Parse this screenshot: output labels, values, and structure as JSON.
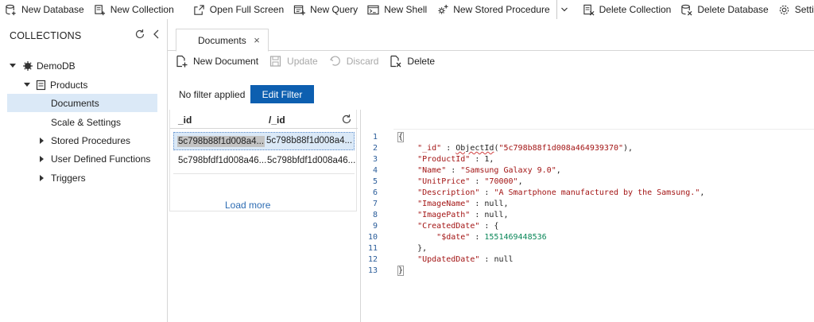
{
  "toolbar": {
    "new_database": "New Database",
    "new_collection": "New Collection",
    "open_full_screen": "Open Full Screen",
    "new_query": "New Query",
    "new_shell": "New Shell",
    "new_stored_procedure": "New Stored Procedure",
    "delete_collection": "Delete Collection",
    "delete_database": "Delete Database",
    "settings": "Settings"
  },
  "sidebar": {
    "header": "COLLECTIONS",
    "database": "DemoDB",
    "collection": "Products",
    "items": [
      {
        "label": "Documents",
        "selected": true
      },
      {
        "label": "Scale & Settings"
      },
      {
        "label": "Stored Procedures",
        "expandable": true
      },
      {
        "label": "User Defined Functions",
        "expandable": true
      },
      {
        "label": "Triggers",
        "expandable": true
      }
    ]
  },
  "tab": {
    "label": "Documents",
    "close": "×"
  },
  "commands": {
    "new_document": "New Document",
    "update": "Update",
    "discard": "Discard",
    "delete": "Delete"
  },
  "filter": {
    "status": "No filter applied",
    "edit_button": "Edit Filter"
  },
  "documents": {
    "columns": [
      "_id",
      "/_id"
    ],
    "rows": [
      {
        "id": "5c798b88f1d008a4...",
        "pk": "5c798b88f1d008a4...",
        "selected": true
      },
      {
        "id": "5c798bfdf1d008a46...",
        "pk": "5c798bfdf1d008a46..."
      }
    ],
    "load_more": "Load more"
  },
  "editor": {
    "line_numbers": [
      "1",
      "2",
      "3",
      "4",
      "5",
      "6",
      "7",
      "8",
      "9",
      "10",
      "11",
      "12",
      "13"
    ],
    "id_value": "5c798b88f1d008a464939370",
    "product_id": "1",
    "name": "Samsung Galaxy 9.0",
    "unit_price": "70000",
    "description": "A Smartphone manufactured by the Samsung.",
    "created_date": "1551469448536"
  },
  "colors": {
    "accent": "#0d5fb0",
    "selection": "#dbe9f7",
    "json_key": "#a31515",
    "json_number": "#098658",
    "link": "#2d6cb3"
  }
}
